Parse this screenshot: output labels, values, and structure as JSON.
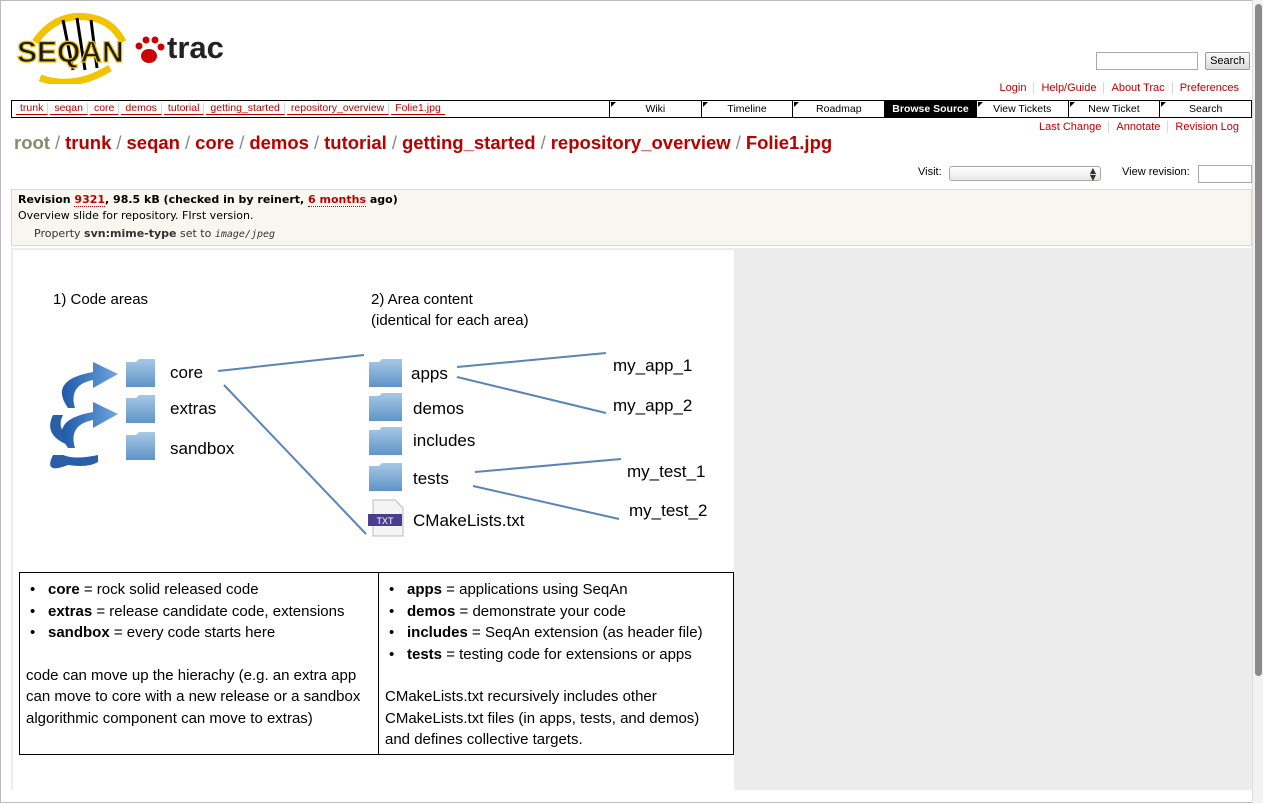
{
  "logo": {
    "text_left": "SEQAN",
    "text_right": "trac"
  },
  "search": {
    "button_label": "Search",
    "placeholder": ""
  },
  "metanav": [
    "Login",
    "Help/Guide",
    "About Trac",
    "Preferences"
  ],
  "path_links": [
    "trunk",
    "seqan",
    "core",
    "demos",
    "tutorial",
    "getting_started",
    "repository_overview",
    "Folie1.jpg"
  ],
  "mainnav": [
    "Wiki",
    "Timeline",
    "Roadmap",
    "Browse Source",
    "View Tickets",
    "New Ticket",
    "Search"
  ],
  "mainnav_active": "Browse Source",
  "ctxtnav": [
    "Last Change",
    "Annotate",
    "Revision Log"
  ],
  "breadcrumb": {
    "root": "root",
    "separator": "/",
    "segments": [
      "trunk",
      "seqan",
      "core",
      "demos",
      "tutorial",
      "getting_started",
      "repository_overview",
      "Folie1.jpg"
    ]
  },
  "visit": {
    "label": "Visit:"
  },
  "revision_view": {
    "label": "View revision:"
  },
  "info": {
    "revision_label": "Revision",
    "revision_number": "9321",
    "size_text": ", 98.5 kB (checked in by reinert, ",
    "age": "6 months",
    "age_suffix": " ago)",
    "message": "Overview slide for repository. FIrst version.",
    "property_prefix": "Property",
    "property_name": "svn:mime-type",
    "property_mid": "set to",
    "property_value": "image/jpeg"
  },
  "slide": {
    "heading_left": "1) Code areas",
    "heading_right_1": "2) Area content",
    "heading_right_2": "(identical for each area)",
    "areas": [
      "core",
      "extras",
      "sandbox"
    ],
    "contents": [
      "apps",
      "demos",
      "includes",
      "tests",
      "CMakeLists.txt"
    ],
    "txt_badge": "TXT",
    "apps": [
      "my_app_1",
      "my_app_2"
    ],
    "tests": [
      "my_test_1",
      "my_test_2"
    ],
    "left_box": {
      "items": [
        {
          "term": "core",
          "desc": " = rock solid released code"
        },
        {
          "term": "extras",
          "desc": " = release candidate code, extensions"
        },
        {
          "term": "sandbox",
          "desc": " = every code starts here"
        }
      ],
      "note": "code can move up the hierachy (e.g. an extra app can move to core with a new release or a sandbox algorithmic component can move to extras)"
    },
    "right_box": {
      "items": [
        {
          "term": "apps",
          "desc": " = applications using SeqAn"
        },
        {
          "term": "demos",
          "desc": " = demonstrate your code"
        },
        {
          "term": "includes",
          "desc": " = SeqAn extension (as header file)"
        },
        {
          "term": "tests",
          "desc": " = testing code for extensions or apps"
        }
      ],
      "note": "CMakeLists.txt recursively includes other CMakeLists.txt files (in apps, tests, and demos) and defines collective targets."
    }
  },
  "colors": {
    "link": "#bb0000",
    "folder": "#6d9fcf",
    "arrow": "#3a78c4",
    "line": "#5b84b6",
    "info_bg": "#f7f7f0"
  }
}
